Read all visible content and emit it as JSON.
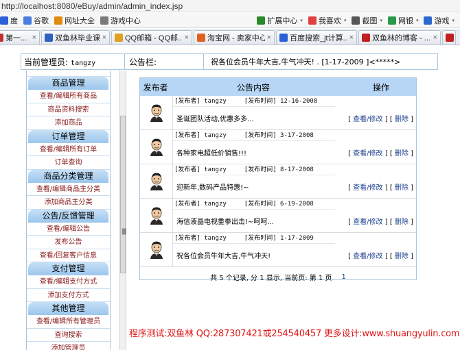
{
  "browser": {
    "address": "http://localhost:8080/eBuy/admin/admin_index.jsp",
    "bookmarks": [
      {
        "label": "度",
        "icon": "baidu-icon",
        "color": "#2b60d6"
      },
      {
        "label": "谷歌",
        "icon": "google-icon",
        "color": "#4a7fe0"
      },
      {
        "label": "网址大全",
        "icon": "sitenav-icon",
        "color": "#e08a10"
      },
      {
        "label": "游戏中心",
        "icon": "gamepad-icon",
        "color": "#7a7a7a"
      }
    ],
    "bookmarks_right": [
      {
        "label": "扩展中心",
        "icon": "extension-icon",
        "color": "#2a8a2a"
      },
      {
        "label": "我喜欢",
        "icon": "heart-icon",
        "color": "#e04040"
      },
      {
        "label": "截图",
        "icon": "scissors-icon",
        "color": "#555555"
      },
      {
        "label": "网银",
        "icon": "bank-icon",
        "color": "#2a9a4a"
      },
      {
        "label": "游戏",
        "icon": "game-icon",
        "color": "#2a6ad0"
      }
    ],
    "tabs": [
      {
        "title": "第一...",
        "color": "#c03030"
      },
      {
        "title": "双鱼林毕业课程...",
        "color": "#3060c0"
      },
      {
        "title": "QQ邮箱 - QQ邮...",
        "color": "#e0a020"
      },
      {
        "title": "淘宝网 - 卖家中心",
        "color": "#e06020"
      },
      {
        "title": "百度搜索_jt计算...",
        "color": "#2b60d6"
      },
      {
        "title": "双鱼林的博客 - ...",
        "color": "#c02020"
      },
      {
        "title": "",
        "color": "#c02020"
      }
    ]
  },
  "header": {
    "admin_label": "当前管理员:",
    "admin_name": "tangzy",
    "board_label": "公告栏:",
    "board_text": "祝各位会员牛年大吉,牛气冲天! . [1-17-2009 ]<*****>"
  },
  "menu": [
    {
      "title": "商品管理",
      "items": [
        "查看/编辑所有商品",
        "商品资料搜索",
        "添加商品"
      ]
    },
    {
      "title": "订单管理",
      "items": [
        "查看/编辑所有订单",
        "订单查询"
      ]
    },
    {
      "title": "商品分类管理",
      "items": [
        "查看/编辑商品主分类",
        "添加商品主分类"
      ]
    },
    {
      "title": "公告/反馈管理",
      "items": [
        "查看/编辑公告",
        "发布公告",
        "查看/回复客户信息"
      ]
    },
    {
      "title": "支付管理",
      "items": [
        "查看/编辑支付方式",
        "添加支付方式"
      ]
    },
    {
      "title": "其他管理",
      "items": [
        "查看/编辑所有管理员",
        "查询搜索",
        "添加管理员"
      ]
    }
  ],
  "notice_table": {
    "col_publisher": "发布者",
    "col_content": "公告内容",
    "col_ops": "操作",
    "publisher_tag": "[发布者]",
    "time_tag": "[发布时间]",
    "view_label": "查看/修改",
    "delete_label": "删除",
    "rows": [
      {
        "publisher": "tangzy",
        "time": "12-16-2008",
        "content": "圣诞团队活动,优惠多多..."
      },
      {
        "publisher": "tangzy",
        "time": "3-17-2008",
        "content": "各种家电超低价销售!!!"
      },
      {
        "publisher": "tangzy",
        "time": "8-17-2008",
        "content": "迎新年,数码产品特惠!~"
      },
      {
        "publisher": "tangzy",
        "time": "6-19-2008",
        "content": "海信液晶电视重拳出击!~呵呵..."
      },
      {
        "publisher": "tangzy",
        "time": "1-17-2009",
        "content": "祝各位会员牛年大吉,牛气冲天!"
      }
    ],
    "pager_text": "共 5 个记录, 分 1 显示, 当前页: 第 1 页",
    "pager_link": "1"
  },
  "footer": {
    "credit": "程序测试:双鱼林 QQ:287307421或254540457 更多设计:www.shuangyulin.com"
  }
}
